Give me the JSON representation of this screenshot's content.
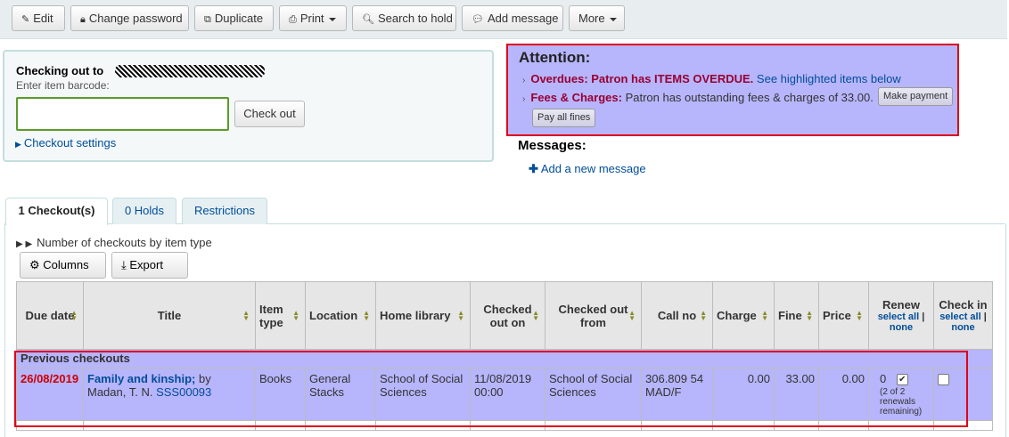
{
  "toolbar": {
    "edit": "Edit",
    "change_password": "Change password",
    "duplicate": "Duplicate",
    "print": "Print",
    "search_to_hold": "Search to hold",
    "add_message": "Add message",
    "more": "More"
  },
  "checkout": {
    "title": "Checking out to",
    "hint": "Enter item barcode:",
    "barcode_value": "",
    "button": "Check out",
    "settings": "Checkout settings"
  },
  "attention": {
    "title": "Attention:",
    "overdues_label": "Overdues: Patron has ITEMS OVERDUE.",
    "overdues_link": "See highlighted items below",
    "fees_label": "Fees & Charges:",
    "fees_text": "Patron has outstanding fees & charges of 33.00.",
    "make_payment": "Make payment",
    "pay_all": "Pay all fines"
  },
  "messages": {
    "title": "Messages:",
    "add": "Add a new message"
  },
  "tabs": [
    "1 Checkout(s)",
    "0 Holds",
    "Restrictions"
  ],
  "checkouts": {
    "counts_label": "Number of checkouts by item type",
    "columns_btn": "Columns",
    "export_btn": "Export",
    "headers": {
      "due": "Due date",
      "title": "Title",
      "itemtype": "Item type",
      "location": "Location",
      "homelib": "Home library",
      "checkedon": "Checked out on",
      "checkedfrom": "Checked out from",
      "callno": "Call no",
      "charge": "Charge",
      "fine": "Fine",
      "price": "Price",
      "renew": "Renew",
      "checkin": "Check in",
      "select_all": "select all",
      "none": "none",
      "sep": "|"
    },
    "group_label": "Previous checkouts",
    "row": {
      "due": "26/08/2019",
      "title": "Family and kinship;",
      "author": "by Madan, T. N.",
      "barcode": "SSS00093",
      "itemtype": "Books",
      "location": "General Stacks",
      "homelib": "School of Social Sciences",
      "checkedon": "11/08/2019 00:00",
      "checkedfrom": "School of Social Sciences",
      "callno": "306.809 54 MAD/F",
      "charge": "0.00",
      "fine": "33.00",
      "price": "0.00",
      "renew_count": "0",
      "renew_note": "(2 of 2 renewals remaining)"
    }
  },
  "colors": {
    "overdue_bg": "#b7b5fb",
    "highlight_border": "#e0001a",
    "link": "#004d99",
    "due_red": "#cc0000"
  }
}
